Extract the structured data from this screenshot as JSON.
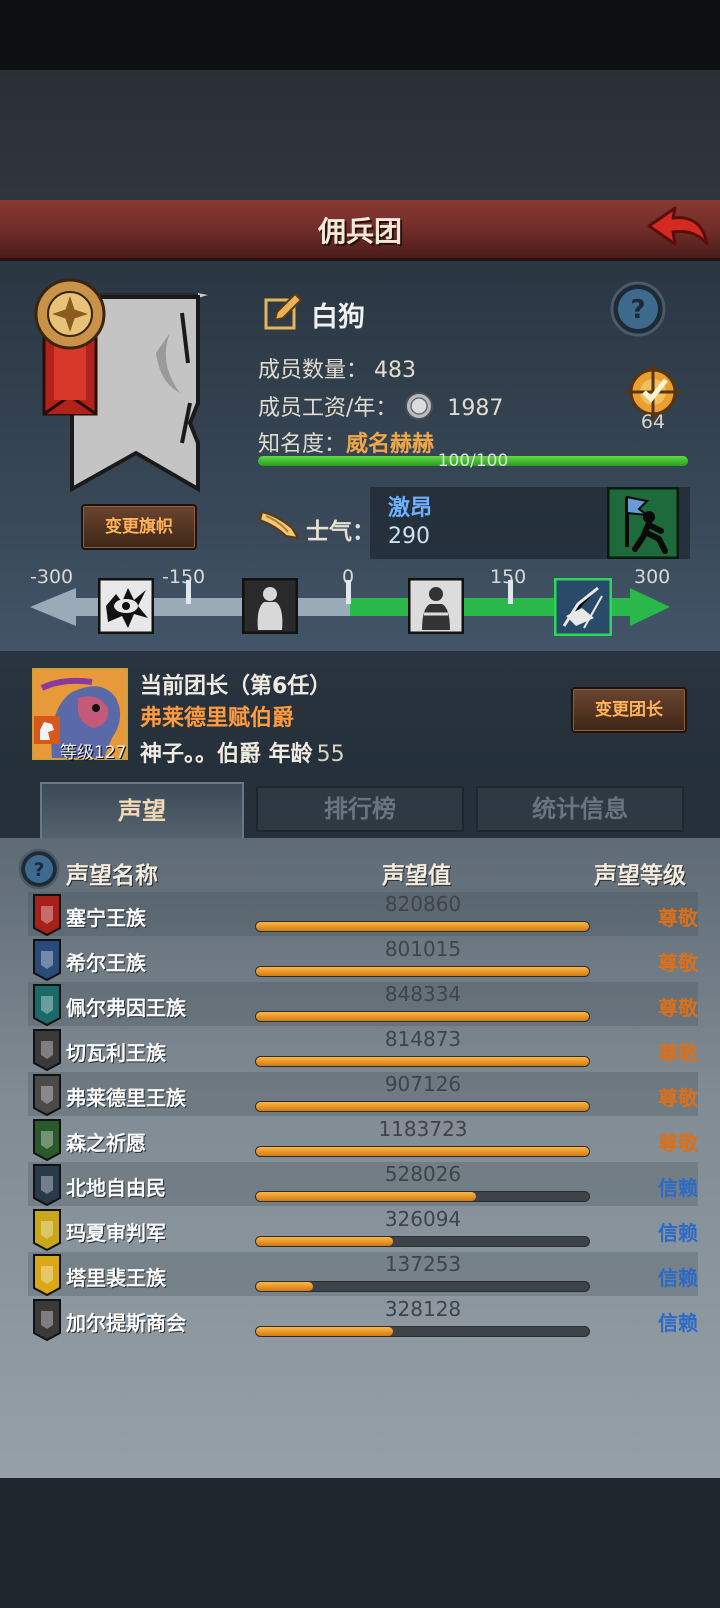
{
  "screen": {
    "title": "佣兵团"
  },
  "company": {
    "name": "白狗",
    "members_label": "成员数量：",
    "members_value": "483",
    "salary_label": "成员工资/年：",
    "salary_value": "1987",
    "fame_label": "知名度：",
    "fame_value": "威名赫赫",
    "fame_bar_text": "100/100",
    "fame_progress": 1.0,
    "target_value": "64",
    "change_banner_label": "变更旗帜"
  },
  "morale": {
    "label": "士气：",
    "state": "激昂",
    "value": "290",
    "scale_labels": [
      "-300",
      "-150",
      "0",
      "150",
      "300"
    ],
    "scale_values": [
      -300,
      -150,
      0,
      150,
      300
    ],
    "current": 290
  },
  "leader": {
    "line1": "当前团长（第6任）",
    "title": "弗莱德里赋伯爵",
    "level_label": "等级127",
    "desc": "神子。。伯爵  年龄",
    "age": "55",
    "change_label": "变更团长"
  },
  "tabs": [
    {
      "label": "声望",
      "active": true
    },
    {
      "label": "排行榜",
      "active": false
    },
    {
      "label": "统计信息",
      "active": false
    }
  ],
  "reputation": {
    "headers": {
      "name": "声望名称",
      "value": "声望值",
      "level": "声望等级"
    },
    "rows": [
      {
        "name": "塞宁王族",
        "value": "820860",
        "level": "尊敬",
        "progress": 1.0,
        "crest": "red-crest-icon"
      },
      {
        "name": "希尔王族",
        "value": "801015",
        "level": "尊敬",
        "progress": 1.0,
        "crest": "blue-crest-icon"
      },
      {
        "name": "佩尔弗因王族",
        "value": "848334",
        "level": "尊敬",
        "progress": 1.0,
        "crest": "teal-crest-icon"
      },
      {
        "name": "切瓦利王族",
        "value": "814873",
        "level": "尊敬",
        "progress": 1.0,
        "crest": "scales-crest-icon"
      },
      {
        "name": "弗莱德里王族",
        "value": "907126",
        "level": "尊敬",
        "progress": 1.0,
        "crest": "grey-crest-icon"
      },
      {
        "name": "森之祈愿",
        "value": "1183723",
        "level": "尊敬",
        "progress": 1.0,
        "crest": "tree-crest-icon"
      },
      {
        "name": "北地自由民",
        "value": "528026",
        "level": "信赖",
        "progress": 0.66,
        "crest": "axe-crest-icon"
      },
      {
        "name": "玛夏审判军",
        "value": "326094",
        "level": "信赖",
        "progress": 0.41,
        "crest": "yellow-crest-icon"
      },
      {
        "name": "塔里裴王族",
        "value": "137253",
        "level": "信赖",
        "progress": 0.17,
        "crest": "crown-crest-icon"
      },
      {
        "name": "加尔提斯商会",
        "value": "328128",
        "level": "信赖",
        "progress": 0.41,
        "crest": "chest-crest-icon"
      }
    ]
  },
  "colors": {
    "accent": "#ff9a3e",
    "respect": "#d8701c",
    "trust": "#2c6ac8",
    "bar_fill": "#f0a030"
  }
}
